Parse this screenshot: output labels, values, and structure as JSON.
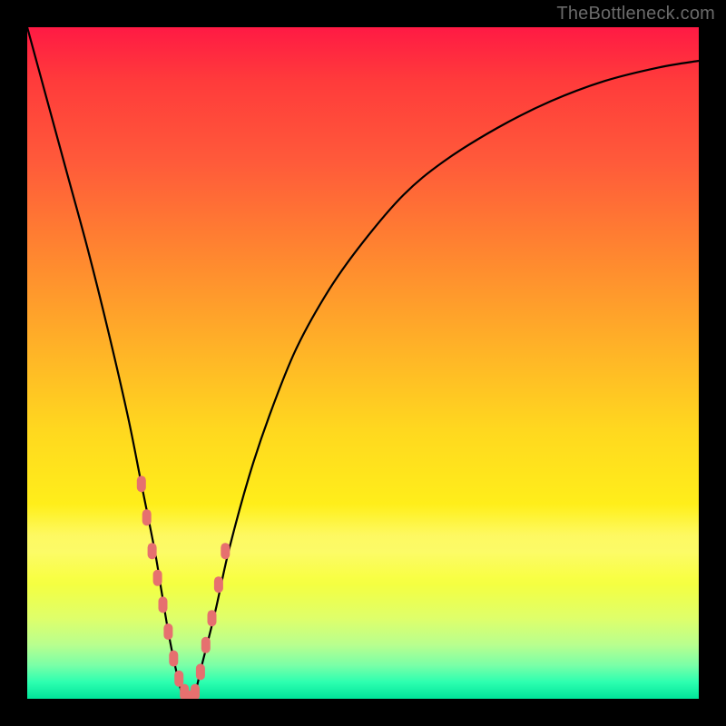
{
  "watermark": "TheBottleneck.com",
  "colors": {
    "frame": "#000000",
    "curve": "#000000",
    "marker": "#e6706f",
    "gradient_top": "#ff1a44",
    "gradient_bottom": "#00e59a"
  },
  "chart_data": {
    "type": "line",
    "title": "",
    "xlabel": "",
    "ylabel": "",
    "xlim": [
      0,
      100
    ],
    "ylim": [
      0,
      100
    ],
    "series": [
      {
        "name": "bottleneck-curve",
        "x": [
          0,
          3,
          6,
          9,
          12,
          15,
          17,
          19,
          20,
          21,
          22,
          23,
          24,
          25,
          26,
          28,
          30,
          33,
          36,
          40,
          45,
          50,
          56,
          62,
          70,
          78,
          86,
          94,
          100
        ],
        "values": [
          100,
          89,
          78,
          67,
          55,
          42,
          32,
          22,
          16,
          10,
          5,
          1,
          0,
          1,
          5,
          13,
          22,
          33,
          42,
          52,
          61,
          68,
          75,
          80,
          85,
          89,
          92,
          94,
          95
        ]
      }
    ],
    "markers": {
      "name": "highlighted-points",
      "x": [
        17.0,
        17.8,
        18.6,
        19.4,
        20.2,
        21.0,
        21.8,
        22.6,
        23.4,
        24.2,
        25.0,
        25.8,
        26.6,
        27.5,
        28.5,
        29.5
      ],
      "values": [
        32,
        27,
        22,
        18,
        14,
        10,
        6,
        3,
        1,
        0,
        1,
        4,
        8,
        12,
        17,
        22
      ]
    },
    "annotations": []
  }
}
